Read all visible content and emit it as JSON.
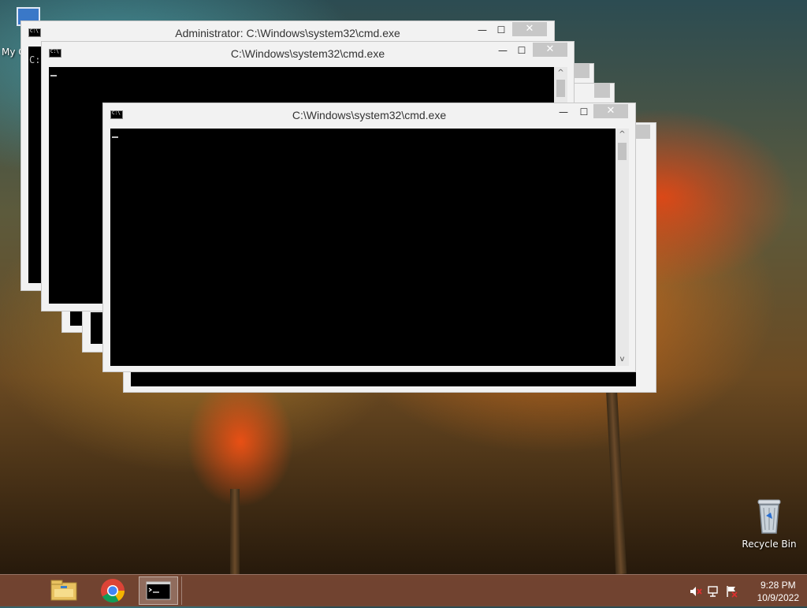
{
  "desktop": {
    "icons": [
      {
        "label": "My C",
        "icon": "computer-icon"
      },
      {
        "label": "Recycle Bin",
        "icon": "recycle-bin-icon"
      }
    ]
  },
  "windows": {
    "admin": {
      "title": "Administrator: C:\\Windows\\system32\\cmd.exe",
      "prompt_fragment": "C:"
    },
    "second": {
      "title": "C:\\Windows\\system32\\cmd.exe"
    },
    "front": {
      "title": "C:\\Windows\\system32\\cmd.exe"
    }
  },
  "controls": {
    "minimize": "—",
    "maximize": "☐",
    "close": "✕",
    "scroll_up": "^",
    "scroll_down": "v"
  },
  "taskbar": {
    "apps": [
      {
        "name": "File Explorer",
        "icon": "file-explorer-icon"
      },
      {
        "name": "Google Chrome",
        "icon": "chrome-icon"
      },
      {
        "name": "Command Prompt",
        "icon": "cmd-icon",
        "active": true
      }
    ],
    "tray_icons": [
      "speaker-muted-icon",
      "network-icon",
      "action-center-flag-icon"
    ],
    "time": "9:28 PM",
    "date": "10/9/2022"
  },
  "colors": {
    "accent_taskbar": "#784834",
    "console_bg": "#000000",
    "window_frame": "#f2f2f2"
  }
}
